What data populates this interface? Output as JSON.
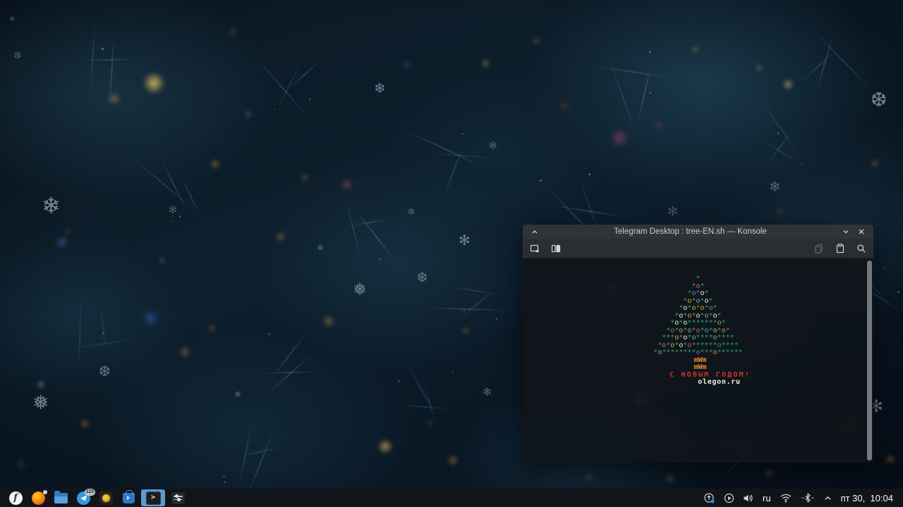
{
  "konsole": {
    "title": "Telegram Desktop : tree-EN.sh — Konsole",
    "titlebar_icons": [
      "keep-above",
      "minimize",
      "close"
    ],
    "toolbar_icons": [
      "new-tab",
      "split-view",
      "copy",
      "paste",
      "search"
    ],
    "terminal": {
      "palette": {
        "G": {
          "ch": "*",
          "color": "#2aa16e"
        },
        "R": {
          "ch": "o",
          "color": "#e05a4a"
        },
        "O": {
          "ch": "o",
          "color": "#ef8b2f"
        },
        "Y": {
          "ch": "o",
          "color": "#e2a93c"
        },
        "P": {
          "ch": "o",
          "color": "#b06fc9"
        },
        "W": {
          "ch": "o",
          "color": "#ececec"
        },
        "E": {
          "ch": "o",
          "color": "#9aa0a6"
        },
        "B": {
          "ch": "o",
          "color": "#4a7dd6"
        },
        "C": {
          "ch": "o",
          "color": "#35b5c9"
        }
      },
      "tree": [
        "G",
        "GRG",
        "GPGWG",
        "GYGEGWG",
        "GWGYGYGPG",
        "GWGYGWGEGWG",
        "GWGWGGGGGGGEG",
        "GRGYGEGRGCGYGOG",
        "GGGYGWGEGGGGEGGGG",
        "GPGYGWGRGGGGGGBGGGG",
        "GEGGGGGGGGBGGGOGGGGGG"
      ],
      "trunk": [
        "mWm",
        "mWm"
      ],
      "greeting": "С НОВЫМ ГОДОМ!",
      "site": "olegon.ru",
      "colors": {
        "trunk": "#ef8b2f",
        "greeting": "#cf3528",
        "site": "#f2f2f2",
        "background": "#10151a"
      }
    }
  },
  "taskbar": {
    "apps": [
      "fedora-launcher",
      "firefox",
      "file-manager",
      "telegram",
      "gold-disc-app",
      "discover",
      "konsole",
      "sliders-app"
    ],
    "active_app": "konsole",
    "telegram_badge": "115",
    "konsole_glyph": ">",
    "fedora_glyph": "f",
    "tray_icons": [
      "device-notifier",
      "media-player",
      "volume",
      "keyboard-layout",
      "wifi",
      "bluetooth",
      "expand-tray"
    ],
    "keyboard_layout": "ru",
    "clock": "пт 30,  10:04",
    "accent_color": "#5b9bd0"
  }
}
